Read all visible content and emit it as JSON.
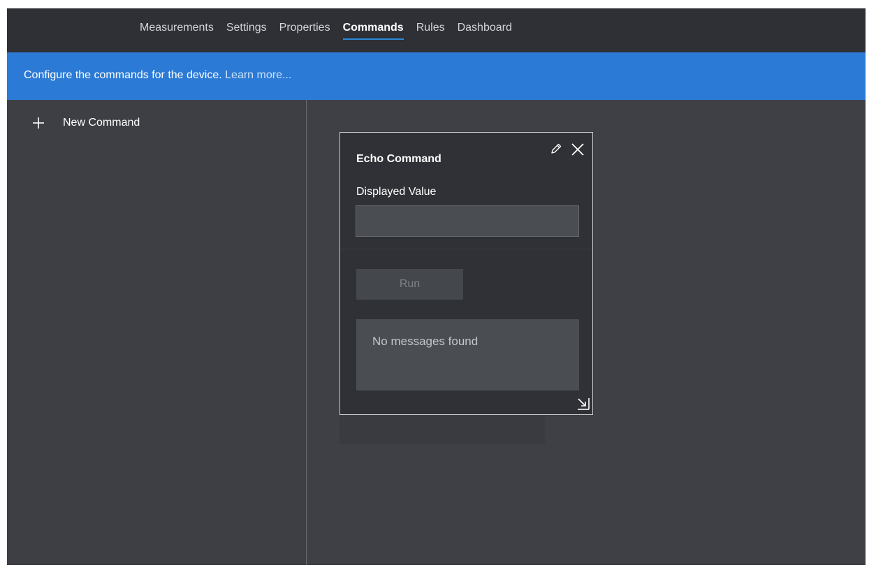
{
  "nav": {
    "tabs": [
      {
        "label": "Measurements"
      },
      {
        "label": "Settings"
      },
      {
        "label": "Properties"
      },
      {
        "label": "Commands",
        "active": true
      },
      {
        "label": "Rules"
      },
      {
        "label": "Dashboard"
      }
    ]
  },
  "banner": {
    "text": "Configure the commands for the device.",
    "link": "Learn more..."
  },
  "sidebar": {
    "new_command_label": "New Command",
    "icon": "plus-icon"
  },
  "command_card": {
    "title": "Echo Command",
    "field_label": "Displayed Value",
    "field_value": "",
    "run_label": "Run",
    "messages_text": "No messages found",
    "icons": [
      "edit-icon",
      "close-icon",
      "resize-icon"
    ]
  },
  "colors": {
    "accent": "#2b7ad6",
    "tab_underline": "#2b88d8",
    "background": "#3a3c41"
  }
}
